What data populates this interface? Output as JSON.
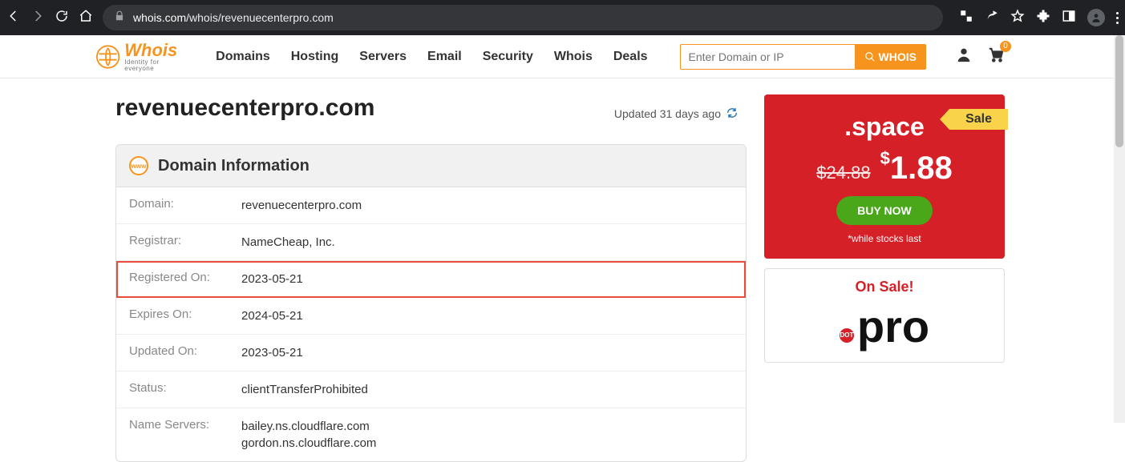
{
  "browser": {
    "url_domain": "whois.com",
    "url_path": "/whois/revenuecenterpro.com"
  },
  "site": {
    "logo_main": "Whois",
    "logo_sub": "Identity for everyone",
    "nav": [
      "Domains",
      "Hosting",
      "Servers",
      "Email",
      "Security",
      "Whois",
      "Deals"
    ],
    "search_placeholder": "Enter Domain or IP",
    "search_button": "WHOIS",
    "cart_count": "0"
  },
  "page": {
    "domain_title": "revenuecenterpro.com",
    "updated": "Updated 31 days ago",
    "info_header": "Domain Information",
    "rows": [
      {
        "label": "Domain:",
        "value": "revenuecenterpro.com",
        "hl": false
      },
      {
        "label": "Registrar:",
        "value": "NameCheap, Inc.",
        "hl": false
      },
      {
        "label": "Registered On:",
        "value": "2023-05-21",
        "hl": true
      },
      {
        "label": "Expires On:",
        "value": "2024-05-21",
        "hl": false
      },
      {
        "label": "Updated On:",
        "value": "2023-05-21",
        "hl": false
      },
      {
        "label": "Status:",
        "value": "clientTransferProhibited",
        "hl": false
      },
      {
        "label": "Name Servers:",
        "value": "bailey.ns.cloudflare.com\ngordon.ns.cloudflare.com",
        "hl": false
      }
    ]
  },
  "promo1": {
    "sale": "Sale",
    "tld": ".space",
    "old": "$24.88",
    "new_cur": "$",
    "new_price": "1.88",
    "buy": "BUY NOW",
    "stock": "*while stocks last"
  },
  "promo2": {
    "title": "On Sale!",
    "dot": "DOT",
    "big": "pro"
  }
}
